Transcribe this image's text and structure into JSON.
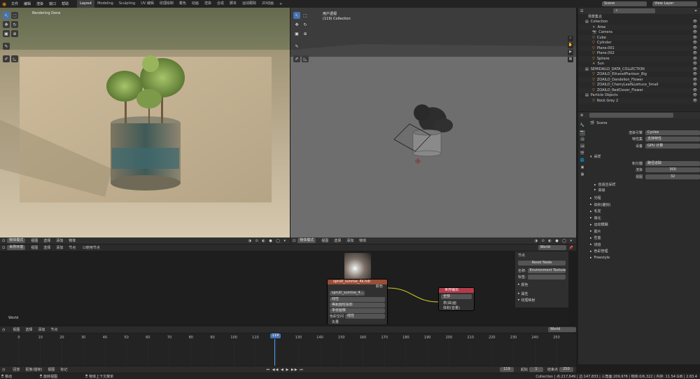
{
  "topbar": {
    "menus": [
      "文件",
      "编辑",
      "渲染",
      "窗口",
      "帮助"
    ],
    "workspaces": [
      "Layout",
      "Modeling",
      "Sculpting",
      "UV 编辑",
      "纹理绘制",
      "着色",
      "动画",
      "渲染",
      "合成",
      "脚本",
      "运动跟踪",
      "2D动画"
    ],
    "active_workspace": "Layout",
    "scene": "Scene",
    "view_layer": "View Layer"
  },
  "left_viewport": {
    "status": "Rendering Done",
    "mode": "物体模式",
    "menu": [
      "视图",
      "选择",
      "添加",
      "物体"
    ],
    "world_label": "World"
  },
  "right_viewport": {
    "title": "用户透视",
    "subtitle": "(119) Collection",
    "mode": "物体模式",
    "menu": [
      "视图",
      "选择",
      "添加",
      "物体"
    ],
    "transform": "全局"
  },
  "outliner": {
    "header": "场景集合",
    "search_placeholder": "",
    "items": [
      {
        "name": "Collection",
        "depth": 0,
        "kind": "collection"
      },
      {
        "name": "Area",
        "depth": 1,
        "kind": "light"
      },
      {
        "name": "Camera",
        "depth": 1,
        "kind": "camera"
      },
      {
        "name": "Cube",
        "depth": 1,
        "kind": "mesh"
      },
      {
        "name": "Cylinder",
        "depth": 1,
        "kind": "mesh"
      },
      {
        "name": "Plane.001",
        "depth": 1,
        "kind": "mesh"
      },
      {
        "name": "Plane.002",
        "depth": 1,
        "kind": "mesh"
      },
      {
        "name": "Sphere",
        "depth": 1,
        "kind": "mesh"
      },
      {
        "name": "Sun",
        "depth": 1,
        "kind": "light"
      },
      {
        "name": "SEMIDAILD_DATA_COLLECTION",
        "depth": 0,
        "kind": "collection"
      },
      {
        "name": "ZOAILD_EthanolPlantsor_Big",
        "depth": 1,
        "kind": "mesh"
      },
      {
        "name": "ZOAILD_Dandelion_Flower",
        "depth": 1,
        "kind": "mesh"
      },
      {
        "name": "ZOAILD_CherryLeaf&Lettuce_Small",
        "depth": 1,
        "kind": "mesh"
      },
      {
        "name": "ZOAILD_RedClover_Flower",
        "depth": 1,
        "kind": "mesh"
      },
      {
        "name": "Particle Objects",
        "depth": 0,
        "kind": "collection"
      },
      {
        "name": "Rock Grey 2",
        "depth": 1,
        "kind": "mesh"
      }
    ]
  },
  "properties": {
    "scene_name": "Scene",
    "render_engine_label": "渲染引擎",
    "render_engine": "Cycles",
    "feature_set_label": "特性集",
    "feature_set": "支持特性",
    "device_label": "设备",
    "device": "GPU 计算",
    "sections": [
      "采样"
    ],
    "integrator_label": "积分器",
    "integrator": "路径追踪",
    "render_label": "渲染",
    "render_samples": "300",
    "viewport_label": "视图",
    "viewport_samples": "32",
    "adaptive_sampling": "自适应采样",
    "advanced": "高级",
    "collapsed_sections": [
      "光程",
      "体积(雕刻)",
      "毛发",
      "简化",
      "运动模糊",
      "胶片",
      "性能",
      "烘焙",
      "色彩管理",
      "Freestyle"
    ],
    "hair_checked": "毛发",
    "subtitle_motion": "运动模糊"
  },
  "node_editor": {
    "editor_type": "世界环境",
    "menu": [
      "视图",
      "选择",
      "添加",
      "节点"
    ],
    "use_nodes": "使用节点",
    "slot": "World",
    "world_name": "World",
    "env_node": {
      "title": "spruit_sunrise_4k.hdr",
      "color_out": "颜色",
      "image_name": "spruit_sunrise_4...",
      "interp": "线性",
      "projection": "等距圆柱投影",
      "source": "单张图像",
      "colorspace_label": "色彩空间",
      "colorspace": "线性",
      "vector_in": "矢量"
    },
    "output_node": {
      "title": "世界输出",
      "target": "全部",
      "surface": "表(曲)面",
      "volume": "体积(音量)"
    },
    "sidebar": {
      "title": "节点",
      "reset": "Reset Node",
      "name_label": "名称:",
      "name": "Environment Texture",
      "label_label": "标签:",
      "color_label": "颜色",
      "props_label": "属性",
      "texture_map": "纹理映射",
      "tabs": [
        "Node Wrangler",
        "选项",
        "工具",
        "节点"
      ]
    }
  },
  "timeline": {
    "editor": "回放",
    "menu": [
      "回放",
      "抠像(插帧)",
      "视图",
      "标记"
    ],
    "current_frame": "119",
    "ticks": [
      0,
      10,
      20,
      30,
      40,
      50,
      60,
      70,
      80,
      90,
      100,
      110,
      120,
      130,
      140,
      150,
      160,
      170,
      180,
      190,
      200,
      210,
      220,
      230,
      240,
      250
    ],
    "start_label": "起始",
    "start": "1",
    "end_label": "结束点",
    "end": "250"
  },
  "statusbar": {
    "left": "移动",
    "middle1": "旋转视图",
    "middle2": "物体上下文菜单",
    "right": "Collection | 点:217,649 | 边:147,833 | 三角面:209,978 | 物体:0/6,322 | 内存: 11.54 GiB | 2.83.4"
  },
  "colors": {
    "accent": "#4772b3",
    "env_header": "#9b4e37",
    "output_header": "#b53b4a",
    "viewport_bg": "#656565",
    "render_bg": "#d8c7ab"
  }
}
